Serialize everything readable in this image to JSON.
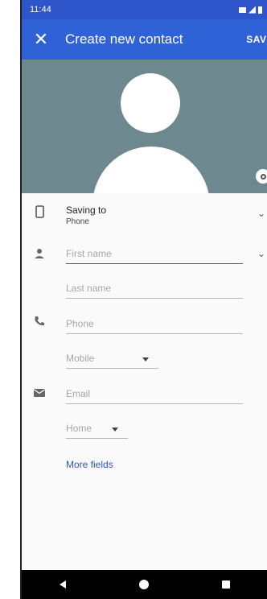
{
  "status_bar": {
    "time": "11:44"
  },
  "app_bar": {
    "title": "Create new contact",
    "save_label": "SAVE"
  },
  "saving_to": {
    "label": "Saving to",
    "value": "Phone"
  },
  "fields": {
    "first_name": {
      "placeholder": "First name"
    },
    "last_name": {
      "placeholder": "Last name"
    },
    "phone": {
      "placeholder": "Phone"
    },
    "phone_type": {
      "value": "Mobile"
    },
    "email": {
      "placeholder": "Email"
    },
    "email_type": {
      "value": "Home"
    }
  },
  "more_fields_label": "More fields",
  "colors": {
    "accent": "#3062d7",
    "status_bar": "#2e55c9",
    "avatar_bg": "#6d888f"
  }
}
